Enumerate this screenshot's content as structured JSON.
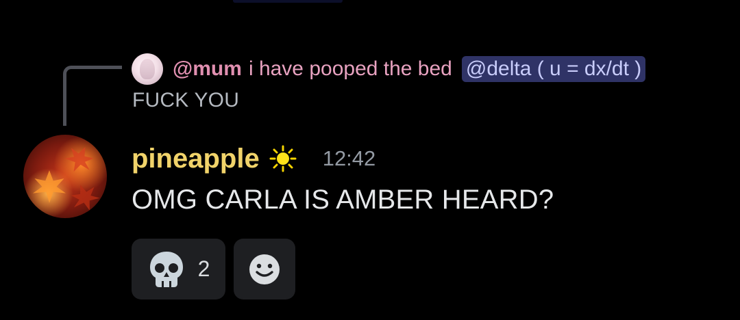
{
  "reply": {
    "author": "@mum",
    "preview_text": "i have pooped the bed",
    "mention": "@delta ( u = dx/dt )",
    "body": "FUCK YOU"
  },
  "message": {
    "username": "pineapple",
    "badge_icon": "sun-icon",
    "timestamp": "12:42",
    "text": "OMG CARLA IS AMBER HEARD?"
  },
  "reactions": [
    {
      "icon": "skull-icon",
      "count": "2"
    },
    {
      "icon": "add-reaction-smiley-icon"
    }
  ],
  "colors": {
    "background": "#000000",
    "reply_author": "#e08fb0",
    "mention_bg": "#2f3366",
    "mention_text": "#c9cdfb",
    "username": "#f1d36a",
    "timestamp": "#949ba4",
    "reaction_bg": "#1e1f22"
  }
}
